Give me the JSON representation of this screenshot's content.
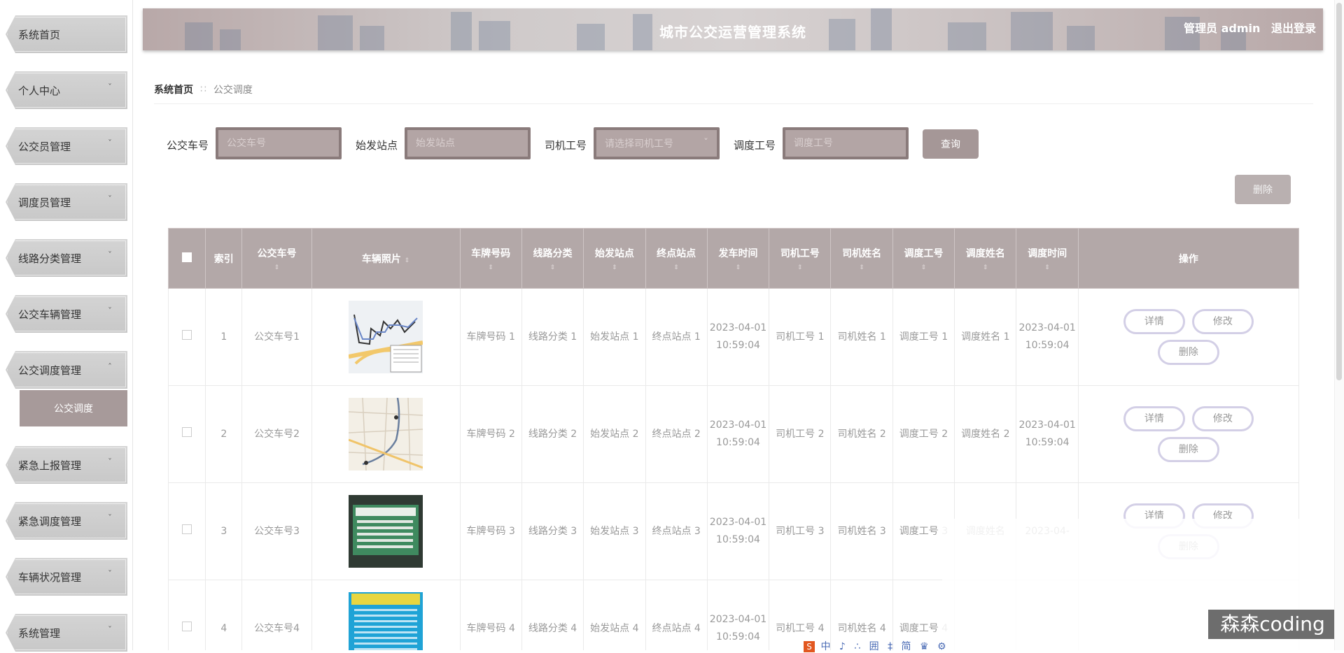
{
  "sidebar": {
    "items": [
      {
        "label": "系统首页",
        "has_chevron": false
      },
      {
        "label": "个人中心",
        "has_chevron": true
      },
      {
        "label": "公交员管理",
        "has_chevron": true
      },
      {
        "label": "调度员管理",
        "has_chevron": true
      },
      {
        "label": "线路分类管理",
        "has_chevron": true
      },
      {
        "label": "公交车辆管理",
        "has_chevron": true
      },
      {
        "label": "公交调度管理",
        "has_chevron": true,
        "expanded": true
      },
      {
        "label": "紧急上报管理",
        "has_chevron": true
      },
      {
        "label": "紧急调度管理",
        "has_chevron": true
      },
      {
        "label": "车辆状况管理",
        "has_chevron": true
      },
      {
        "label": "系统管理",
        "has_chevron": true
      }
    ],
    "submenu_label": "公交调度",
    "chevron_down": "ˇ",
    "chevron_up": "ˆ"
  },
  "header": {
    "title": "城市公交运营管理系统",
    "user_label": "管理员 admin",
    "logout": "退出登录"
  },
  "breadcrumb": {
    "home": "系统首页",
    "separator": "∷",
    "current": "公交调度"
  },
  "search": {
    "bus_no_label": "公交车号",
    "bus_no_placeholder": "公交车号",
    "start_station_label": "始发站点",
    "start_station_placeholder": "始发站点",
    "driver_id_label": "司机工号",
    "driver_id_placeholder": "请选择司机工号",
    "dispatch_id_label": "调度工号",
    "dispatch_id_placeholder": "调度工号",
    "query_button": "查询",
    "delete_button": "删除"
  },
  "table": {
    "headers": [
      "索引",
      "公交车号",
      "车辆照片",
      "车牌号码",
      "线路分类",
      "始发站点",
      "终点站点",
      "发车时间",
      "司机工号",
      "司机姓名",
      "调度工号",
      "调度姓名",
      "调度时间",
      "操作"
    ],
    "sort_glyph": "⇕",
    "actions": {
      "detail": "详情",
      "edit": "修改",
      "delete": "删除"
    },
    "rows": [
      {
        "index": "1",
        "bus_no": "公交车号1",
        "plate": "车牌号码 1",
        "line": "线路分类 1",
        "start": "始发站点 1",
        "end": "终点站点 1",
        "depart": "2023-04-01 10:59:04",
        "driver_id": "司机工号 1",
        "driver_name": "司机姓名 1",
        "dispatch_id": "调度工号 1",
        "dispatch_name": "调度姓名 1",
        "dispatch_time": "2023-04-01 10:59:04",
        "photo": "route-map"
      },
      {
        "index": "2",
        "bus_no": "公交车号2",
        "plate": "车牌号码 2",
        "line": "线路分类 2",
        "start": "始发站点 2",
        "end": "终点站点 2",
        "depart": "2023-04-01 10:59:04",
        "driver_id": "司机工号 2",
        "driver_name": "司机姓名 2",
        "dispatch_id": "调度工号 2",
        "dispatch_name": "调度姓名 2",
        "dispatch_time": "2023-04-01 10:59:04",
        "photo": "street-map"
      },
      {
        "index": "3",
        "bus_no": "公交车号3",
        "plate": "车牌号码 3",
        "line": "线路分类 3",
        "start": "始发站点 3",
        "end": "终点站点 3",
        "depart": "2023-04-01 10:59:04",
        "driver_id": "司机工号 3",
        "driver_name": "司机姓名 3",
        "dispatch_id": "调度工号 3",
        "dispatch_name": "调度姓名",
        "dispatch_time": "2023-04-",
        "photo": "bus-sign"
      },
      {
        "index": "4",
        "bus_no": "公交车号4",
        "plate": "车牌号码 4",
        "line": "线路分类 4",
        "start": "始发站点 4",
        "end": "终点站点 4",
        "depart": "2023-04-01 10:59:04",
        "driver_id": "司机工号 4",
        "driver_name": "司机姓名 4",
        "dispatch_id": "调度工号 4",
        "dispatch_name": "",
        "dispatch_time": "",
        "photo": "bus-schedule"
      }
    ]
  },
  "overlay": {
    "ime_text": "中 ♪ ∴ 囲 ‡ 简 ♛ ⚙",
    "ime_logo": "S",
    "watermark": "森森coding"
  }
}
